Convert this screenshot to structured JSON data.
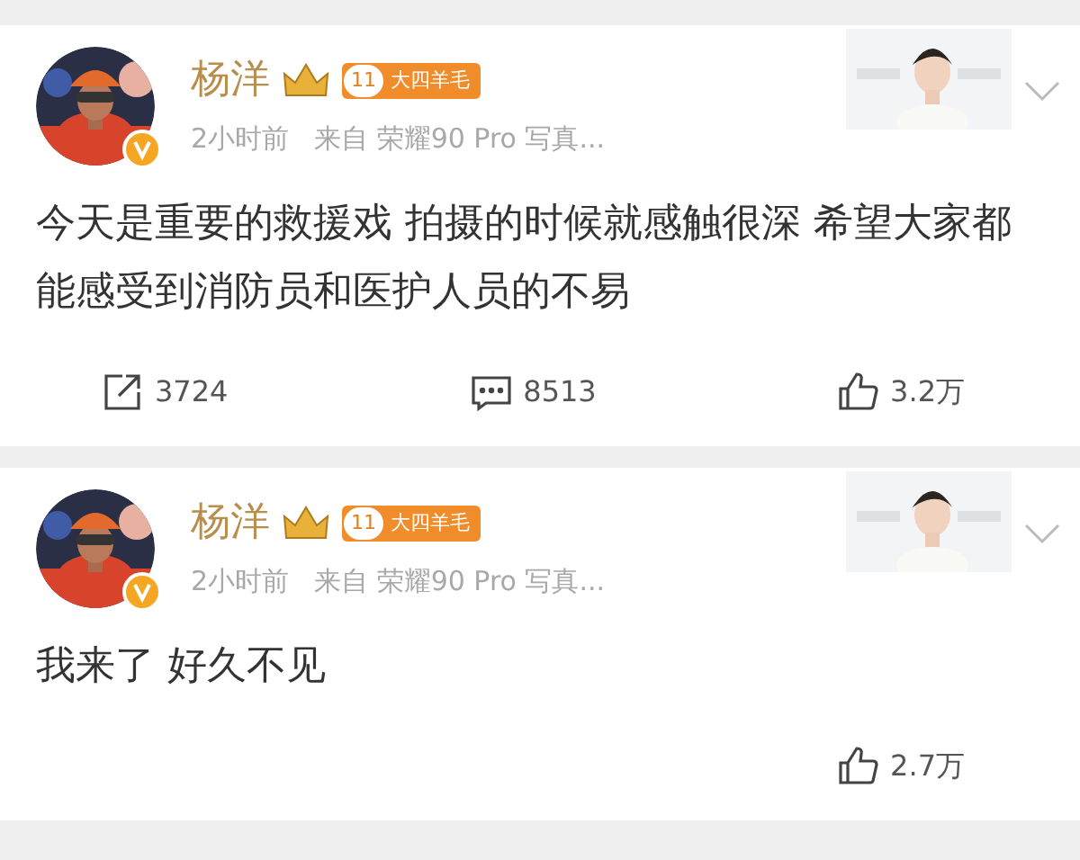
{
  "posts": [
    {
      "author": "杨洋",
      "level": "11",
      "badge": "大四羊毛",
      "time": "2小时前",
      "source": "来自 荣耀90 Pro 写真...",
      "text": "今天是重要的救援戏 拍摄的时候就感触很深 希望大家都能感受到消防员和医护人员的不易",
      "actions": [
        {
          "kind": "repost",
          "count": "3724"
        },
        {
          "kind": "comment",
          "count": "8513"
        },
        {
          "kind": "like",
          "count": "3.2万"
        }
      ]
    },
    {
      "author": "杨洋",
      "level": "11",
      "badge": "大四羊毛",
      "time": "2小时前",
      "source": "来自 荣耀90 Pro 写真...",
      "text": "我来了 好久不见",
      "actions": [
        {
          "kind": "like",
          "count": "2.7万"
        }
      ]
    }
  ]
}
